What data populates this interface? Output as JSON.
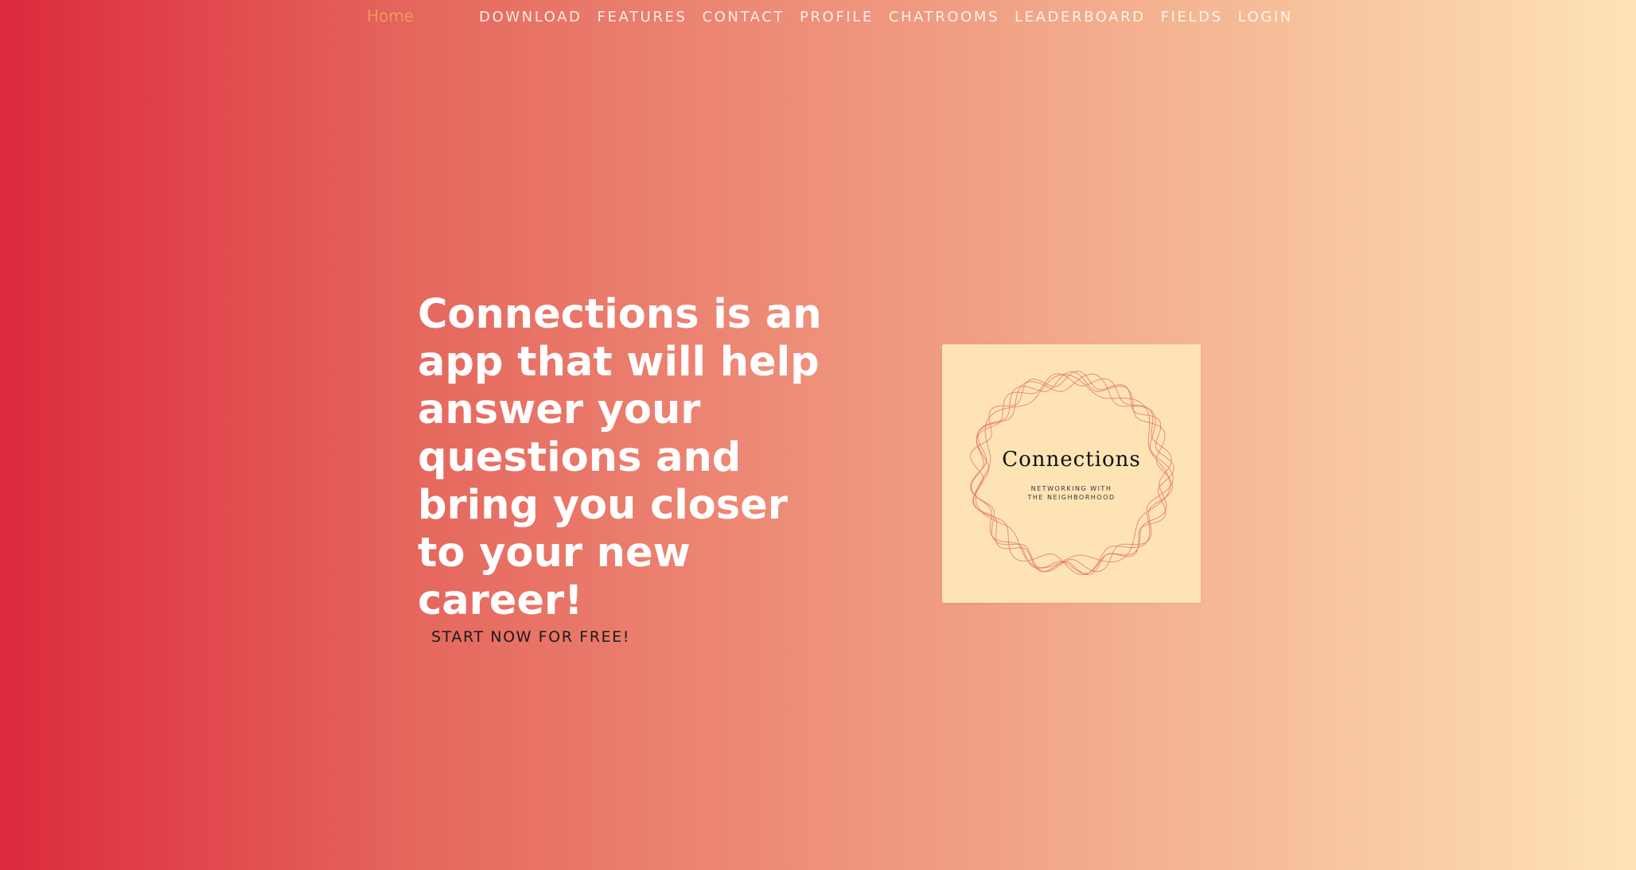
{
  "brand": {
    "label": "Home",
    "color": "#f7c35a"
  },
  "nav": {
    "items": [
      {
        "label": "DOWNLOAD"
      },
      {
        "label": "FEATURES"
      },
      {
        "label": "CONTACT"
      },
      {
        "label": "PROFILE"
      },
      {
        "label": "CHATROOMS"
      },
      {
        "label": "LEADERBOARD"
      },
      {
        "label": "FIELDS"
      },
      {
        "label": "LOGIN"
      }
    ]
  },
  "hero": {
    "heading": "Connections is an app that will help answer your questions and bring you closer to your new career!",
    "cta_label": "START NOW FOR FREE!"
  },
  "logo": {
    "title": "Connections",
    "subtitle": "NETWORKING WITH THE NEIGHBORHOOD",
    "ring_color": "#e0705f",
    "card_color": "#fee4b5"
  },
  "colors": {
    "gradient_start": "#dc2a3c",
    "gradient_end": "#fee4b5"
  }
}
